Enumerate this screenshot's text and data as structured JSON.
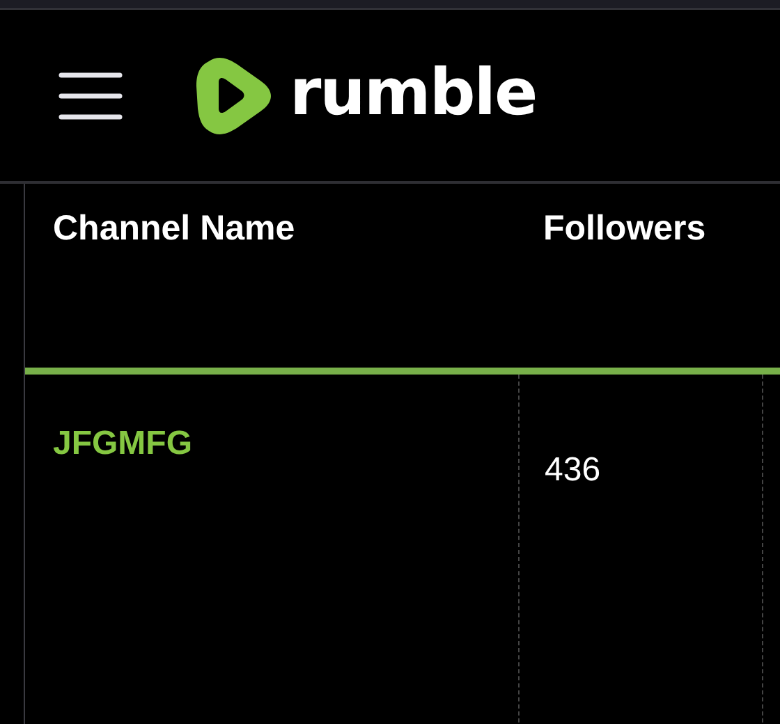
{
  "header": {
    "logo_text": "rumble"
  },
  "table": {
    "columns": [
      "Channel Name",
      "Followers"
    ],
    "rows": [
      {
        "channel_name": "JFGMFG",
        "followers": "436"
      }
    ]
  }
}
